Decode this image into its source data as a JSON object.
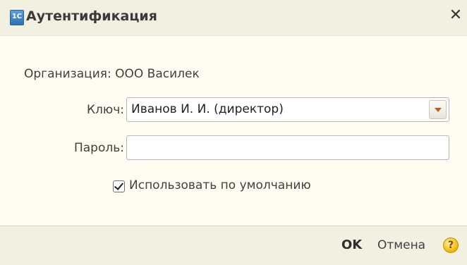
{
  "window": {
    "title": "Аутентификация",
    "app_icon_glyph": "1С",
    "close_glyph": "✕"
  },
  "form": {
    "organization": "Организация: ООО Василек",
    "key_label": "Ключ:",
    "key_value": "Иванов И. И. (директор)",
    "password_label": "Пароль:",
    "password_value": "",
    "default_checkbox_label": "Использовать по умолчанию",
    "default_checked": true
  },
  "footer": {
    "ok_label": "OK",
    "cancel_label": "Отмена",
    "help_glyph": "?"
  },
  "icons": {
    "app": "app-1c-icon",
    "close": "close-icon",
    "dropdown": "chevron-down-icon",
    "help": "help-icon"
  },
  "colors": {
    "title_bar": "#f2f0e1",
    "content_bg": "#fffdf2",
    "dropdown_arrow": "#c45b12",
    "help_icon": "#f2b400"
  }
}
